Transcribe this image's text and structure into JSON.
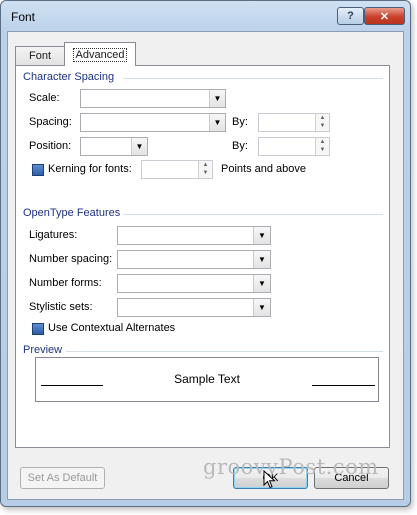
{
  "window": {
    "title": "Font",
    "help_glyph": "?",
    "close_glyph": "✕"
  },
  "tabs": [
    {
      "label": "Font"
    },
    {
      "label": "Advanced"
    }
  ],
  "character_spacing": {
    "title": "Character Spacing",
    "scale_label": "Scale:",
    "spacing_label": "Spacing:",
    "position_label": "Position:",
    "by_label": "By:",
    "by2_label": "By:",
    "kerning_label": "Kerning for fonts:",
    "points_label": "Points and above",
    "kerning_checked": true
  },
  "opentype": {
    "title": "OpenType Features",
    "ligatures_label": "Ligatures:",
    "number_spacing_label": "Number spacing:",
    "number_forms_label": "Number forms:",
    "stylistic_sets_label": "Stylistic sets:",
    "contextual_label": "Use Contextual Alternates",
    "contextual_checked": true
  },
  "preview": {
    "title": "Preview",
    "sample_text": "Sample Text"
  },
  "buttons": {
    "set_default": "Set As Default",
    "ok": "OK",
    "cancel": "Cancel"
  },
  "watermark": "groovyPost.com",
  "icons": {
    "dropdown": "▼",
    "spin_up": "▲",
    "spin_down": "▼"
  }
}
